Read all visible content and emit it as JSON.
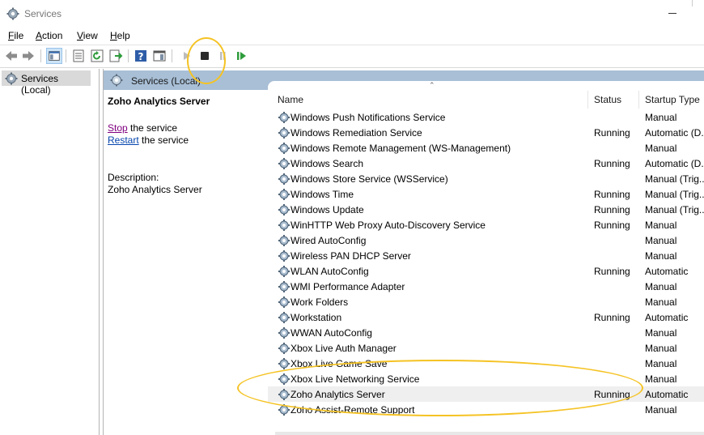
{
  "window": {
    "title": "Services"
  },
  "menu": [
    {
      "label": "File",
      "accel": "F",
      "rest": "ile"
    },
    {
      "label": "Action",
      "accel": "A",
      "rest": "ction"
    },
    {
      "label": "View",
      "accel": "V",
      "rest": "iew"
    },
    {
      "label": "Help",
      "accel": "H",
      "rest": "elp"
    }
  ],
  "tree": {
    "root_label": "Services (Local)"
  },
  "pane_header": {
    "label": "Services (Local)"
  },
  "detail": {
    "service_name": "Zoho Analytics Server",
    "stop_link": "Stop",
    "stop_suffix": " the service",
    "restart_link": "Restart",
    "restart_suffix": " the service",
    "description_label": "Description:",
    "description_text": "Zoho Analytics Server"
  },
  "columns": {
    "name": "Name",
    "status": "Status",
    "startup": "Startup Type"
  },
  "services": [
    {
      "name": "Windows Push Notifications Service",
      "status": "",
      "startup": "Manual"
    },
    {
      "name": "Windows Remediation Service",
      "status": "Running",
      "startup": "Automatic (D..."
    },
    {
      "name": "Windows Remote Management (WS-Management)",
      "status": "",
      "startup": "Manual"
    },
    {
      "name": "Windows Search",
      "status": "Running",
      "startup": "Automatic (D..."
    },
    {
      "name": "Windows Store Service (WSService)",
      "status": "",
      "startup": "Manual (Trig..."
    },
    {
      "name": "Windows Time",
      "status": "Running",
      "startup": "Manual (Trig..."
    },
    {
      "name": "Windows Update",
      "status": "Running",
      "startup": "Manual (Trig..."
    },
    {
      "name": "WinHTTP Web Proxy Auto-Discovery Service",
      "status": "Running",
      "startup": "Manual"
    },
    {
      "name": "Wired AutoConfig",
      "status": "",
      "startup": "Manual"
    },
    {
      "name": "Wireless PAN DHCP Server",
      "status": "",
      "startup": "Manual"
    },
    {
      "name": "WLAN AutoConfig",
      "status": "Running",
      "startup": "Automatic"
    },
    {
      "name": "WMI Performance Adapter",
      "status": "",
      "startup": "Manual"
    },
    {
      "name": "Work Folders",
      "status": "",
      "startup": "Manual"
    },
    {
      "name": "Workstation",
      "status": "Running",
      "startup": "Automatic"
    },
    {
      "name": "WWAN AutoConfig",
      "status": "",
      "startup": "Manual"
    },
    {
      "name": "Xbox Live Auth Manager",
      "status": "",
      "startup": "Manual"
    },
    {
      "name": "Xbox Live Game Save",
      "status": "",
      "startup": "Manual"
    },
    {
      "name": "Xbox Live Networking Service",
      "status": "",
      "startup": "Manual"
    },
    {
      "name": "Zoho Analytics Server",
      "status": "Running",
      "startup": "Automatic",
      "selected": true
    },
    {
      "name": "Zoho Assist-Remote Support",
      "status": "",
      "startup": "Manual"
    }
  ],
  "toolbar": {
    "buttons": [
      "back-icon",
      "forward-icon",
      "show-hide-console-tree-icon",
      "properties-icon",
      "refresh-icon",
      "export-list-icon",
      "help-icon",
      "action-pane-icon",
      "start-service-icon",
      "stop-service-icon",
      "pause-service-icon",
      "restart-service-icon"
    ]
  },
  "colors": {
    "header_blue": "#a8bfd6",
    "annotation": "#f5c324",
    "selected_row": "#efefef",
    "link_purple": "#800080",
    "link_blue": "#0645ad"
  }
}
